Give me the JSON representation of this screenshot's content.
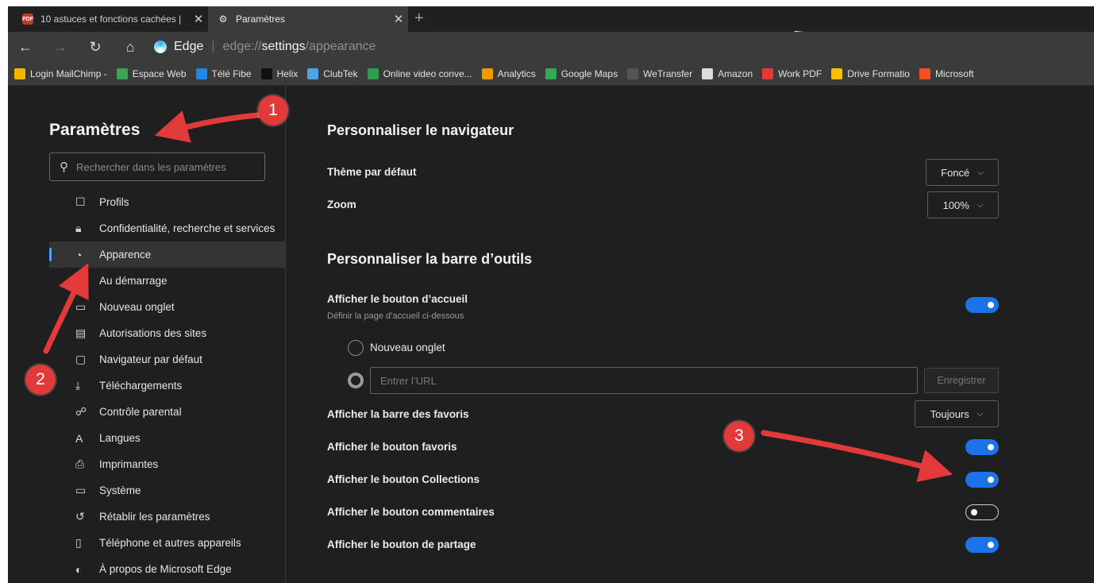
{
  "tabs": [
    {
      "title": "10 astuces et fonctions cachées |",
      "favicon": "pdf-icon"
    },
    {
      "title": "Paramètres",
      "favicon": "gear-icon"
    }
  ],
  "address": {
    "brand": "Edge",
    "url_prefix": "edge://",
    "url_bold": "settings",
    "url_suffix": "/appearance"
  },
  "favorites": [
    {
      "label": "Login MailChimp -",
      "color": "#f5b400"
    },
    {
      "label": "Espace Web",
      "color": "#3aa655"
    },
    {
      "label": "Télé Fibe",
      "color": "#1e88e5"
    },
    {
      "label": "Helix",
      "color": "#111111"
    },
    {
      "label": "ClubTek",
      "color": "#4fa3e0"
    },
    {
      "label": "Online video conve...",
      "color": "#2e9e4a"
    },
    {
      "label": "Analytics",
      "color": "#f29900"
    },
    {
      "label": "Google Maps",
      "color": "#34a853"
    },
    {
      "label": "WeTransfer",
      "color": "#555555"
    },
    {
      "label": "Amazon",
      "color": "#dddddd"
    },
    {
      "label": "Work PDF",
      "color": "#e53935"
    },
    {
      "label": "Drive Formatio",
      "color": "#fbbc04"
    },
    {
      "label": "Microsoft",
      "color": "#f25022"
    }
  ],
  "sidebar": {
    "title": "Paramètres",
    "search_placeholder": "Rechercher dans les paramètres",
    "items": [
      {
        "label": "Profils",
        "icon": "profile-icon"
      },
      {
        "label": "Confidentialité, recherche et services",
        "icon": "lock-icon"
      },
      {
        "label": "Apparence",
        "icon": "palette-icon",
        "active": true
      },
      {
        "label": "Au démarrage",
        "icon": "power-icon"
      },
      {
        "label": "Nouveau onglet",
        "icon": "new-tab-icon"
      },
      {
        "label": "Autorisations des sites",
        "icon": "site-permissions-icon"
      },
      {
        "label": "Navigateur par défaut",
        "icon": "browser-icon"
      },
      {
        "label": "Téléchargements",
        "icon": "download-icon"
      },
      {
        "label": "Contrôle parental",
        "icon": "family-icon"
      },
      {
        "label": "Langues",
        "icon": "language-icon"
      },
      {
        "label": "Imprimantes",
        "icon": "printer-icon"
      },
      {
        "label": "Système",
        "icon": "system-icon"
      },
      {
        "label": "Rétablir les paramètres",
        "icon": "reset-icon"
      },
      {
        "label": "Téléphone et autres appareils",
        "icon": "phone-icon"
      },
      {
        "label": "À propos de Microsoft Edge",
        "icon": "edge-icon"
      }
    ]
  },
  "main": {
    "section1_title": "Personnaliser le navigateur",
    "theme_label": "Thème par défaut",
    "theme_value": "Foncé",
    "zoom_label": "Zoom",
    "zoom_value": "100%",
    "section2_title": "Personnaliser la barre d’outils",
    "home_label": "Afficher le bouton d’accueil",
    "home_sub": "Définir la page d’accueil ci-dessous",
    "home_on": true,
    "radio_newtab": "Nouveau onglet",
    "url_placeholder": "Entrer l’URL",
    "save_label": "Enregistrer",
    "favbar_label": "Afficher la barre des favoris",
    "favbar_value": "Toujours",
    "fav_button_label": "Afficher le bouton favoris",
    "fav_button_on": true,
    "collections_label": "Afficher le bouton Collections",
    "collections_on": true,
    "comments_label": "Afficher le bouton commentaires",
    "comments_on": false,
    "share_label": "Afficher le bouton de partage",
    "share_on": true
  },
  "annotations": {
    "badge1": "1",
    "badge2": "2",
    "badge3": "3",
    "color": "#e23a3a"
  }
}
